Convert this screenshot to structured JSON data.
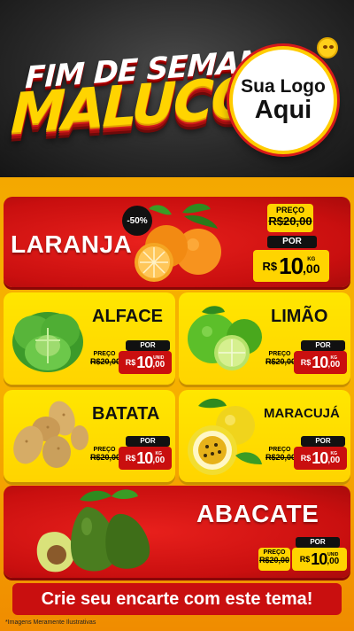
{
  "header": {
    "title_line1": "FIM DE SEMANA",
    "title_line2": "MALUCO",
    "logo_line1": "Sua Logo",
    "logo_line2": "Aqui"
  },
  "products": {
    "laranja": {
      "name": "LARANJA",
      "discount": "-50%",
      "old_label": "PREÇO",
      "old_price": "R$20,00",
      "por_label": "POR",
      "currency": "R$",
      "price_int": "10",
      "price_dec": ",00",
      "unit": "KG"
    },
    "alface": {
      "name": "ALFACE",
      "old_label": "PREÇO",
      "old_price": "R$20,00",
      "por_label": "POR",
      "currency": "R$",
      "price_int": "10",
      "price_dec": ",00",
      "unit": "UNID"
    },
    "limao": {
      "name": "LIMÃO",
      "old_label": "PREÇO",
      "old_price": "R$20,00",
      "por_label": "POR",
      "currency": "R$",
      "price_int": "10",
      "price_dec": ",00",
      "unit": "KG"
    },
    "batata": {
      "name": "BATATA",
      "old_label": "PREÇO",
      "old_price": "R$20,00",
      "por_label": "POR",
      "currency": "R$",
      "price_int": "10",
      "price_dec": ",00",
      "unit": "KG"
    },
    "maracuja": {
      "name": "MARACUJÁ",
      "old_label": "PREÇO",
      "old_price": "R$20,00",
      "por_label": "POR",
      "currency": "R$",
      "price_int": "10",
      "price_dec": ",00",
      "unit": "KG"
    },
    "abacate": {
      "name": "ABACATE",
      "old_label": "PREÇO",
      "old_price": "R$20,00",
      "por_label": "POR",
      "currency": "R$",
      "price_int": "10",
      "price_dec": ",00",
      "unit": "UNID"
    }
  },
  "cta": "Crie seu encarte com este tema!",
  "disclaimer": "*Imagens Meramente Ilustrativas",
  "colors": {
    "red": "#c90f0f",
    "yellow": "#ffd400",
    "orange_bg": "#f4a800",
    "dark": "#151515"
  }
}
